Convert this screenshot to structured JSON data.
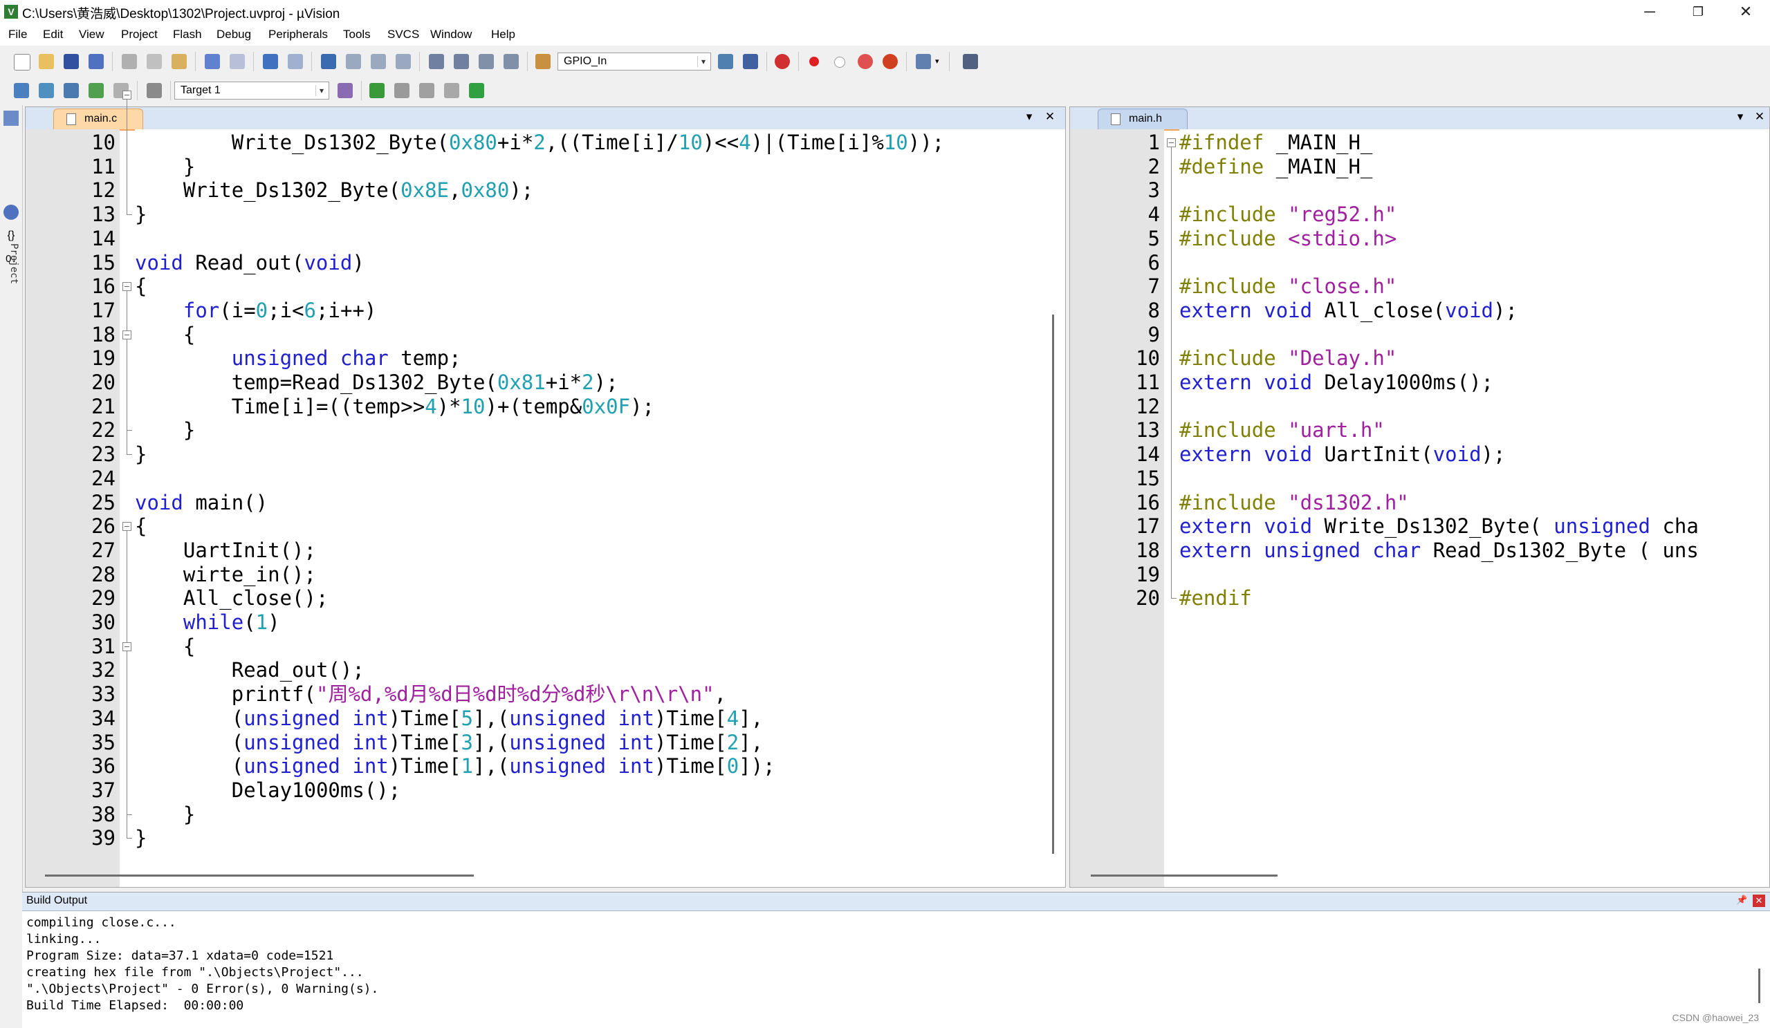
{
  "window": {
    "title": "C:\\Users\\黄浩威\\Desktop\\1302\\Project.uvproj - µVision",
    "minimize": "─",
    "restore": "❐",
    "close": "✕"
  },
  "menu": [
    "File",
    "Edit",
    "View",
    "Project",
    "Flash",
    "Debug",
    "Peripherals",
    "Tools",
    "SVCS",
    "Window",
    "Help"
  ],
  "toolbar": {
    "find_combo": "GPIO_In",
    "target_combo": "Target 1"
  },
  "sidebar": {
    "project_label": "Project"
  },
  "editor_left": {
    "tab": "main.c",
    "pane_menu": "▾",
    "pane_close": "✕",
    "lines": [
      {
        "n": "10",
        "code": "        Write_Ds1302_Byte(0x80+i*2,((Time[i]/10)<<4)|(Time[i]%10));"
      },
      {
        "n": "11",
        "code": "    }"
      },
      {
        "n": "12",
        "code": "    Write_Ds1302_Byte(0x8E,0x80);"
      },
      {
        "n": "13",
        "code": "}"
      },
      {
        "n": "14",
        "code": ""
      },
      {
        "n": "15",
        "code": "void Read_out(void)"
      },
      {
        "n": "16",
        "code": "{"
      },
      {
        "n": "17",
        "code": "    for(i=0;i<6;i++)"
      },
      {
        "n": "18",
        "code": "    {"
      },
      {
        "n": "19",
        "code": "        unsigned char temp;"
      },
      {
        "n": "20",
        "code": "        temp=Read_Ds1302_Byte(0x81+i*2);"
      },
      {
        "n": "21",
        "code": "        Time[i]=((temp>>4)*10)+(temp&0x0F);"
      },
      {
        "n": "22",
        "code": "    }"
      },
      {
        "n": "23",
        "code": "}"
      },
      {
        "n": "24",
        "code": ""
      },
      {
        "n": "25",
        "code": "void main()"
      },
      {
        "n": "26",
        "code": "{"
      },
      {
        "n": "27",
        "code": "    UartInit();"
      },
      {
        "n": "28",
        "code": "    wirte_in();"
      },
      {
        "n": "29",
        "code": "    All_close();"
      },
      {
        "n": "30",
        "code": "    while(1)"
      },
      {
        "n": "31",
        "code": "    {"
      },
      {
        "n": "32",
        "code": "        Read_out();"
      },
      {
        "n": "33",
        "code": "        printf(\"周%d,%d月%d日%d时%d分%d秒\\r\\n\\r\\n\","
      },
      {
        "n": "34",
        "code": "        (unsigned int)Time[5],(unsigned int)Time[4],"
      },
      {
        "n": "35",
        "code": "        (unsigned int)Time[3],(unsigned int)Time[2],"
      },
      {
        "n": "36",
        "code": "        (unsigned int)Time[1],(unsigned int)Time[0]);"
      },
      {
        "n": "37",
        "code": "        Delay1000ms();"
      },
      {
        "n": "38",
        "code": "    }"
      },
      {
        "n": "39",
        "code": "}"
      }
    ]
  },
  "editor_right": {
    "tab": "main.h",
    "pane_menu": "▾",
    "pane_close": "✕",
    "lines": [
      {
        "n": "1",
        "code": "#ifndef _MAIN_H_"
      },
      {
        "n": "2",
        "code": "#define _MAIN_H_"
      },
      {
        "n": "3",
        "code": ""
      },
      {
        "n": "4",
        "code": "#include \"reg52.h\""
      },
      {
        "n": "5",
        "code": "#include <stdio.h>"
      },
      {
        "n": "6",
        "code": ""
      },
      {
        "n": "7",
        "code": "#include \"close.h\""
      },
      {
        "n": "8",
        "code": "extern void All_close(void);"
      },
      {
        "n": "9",
        "code": ""
      },
      {
        "n": "10",
        "code": "#include \"Delay.h\""
      },
      {
        "n": "11",
        "code": "extern void Delay1000ms();"
      },
      {
        "n": "12",
        "code": ""
      },
      {
        "n": "13",
        "code": "#include \"uart.h\""
      },
      {
        "n": "14",
        "code": "extern void UartInit(void);"
      },
      {
        "n": "15",
        "code": ""
      },
      {
        "n": "16",
        "code": "#include \"ds1302.h\""
      },
      {
        "n": "17",
        "code": "extern void Write_Ds1302_Byte( unsigned cha"
      },
      {
        "n": "18",
        "code": "extern unsigned char Read_Ds1302_Byte ( uns"
      },
      {
        "n": "19",
        "code": ""
      },
      {
        "n": "20",
        "code": "#endif"
      }
    ]
  },
  "build_output": {
    "title": "Build Output",
    "pin": "📌",
    "close": "✕",
    "lines": [
      "compiling close.c...",
      "linking...",
      "Program Size: data=37.1 xdata=0 code=1521",
      "creating hex file from \".\\Objects\\Project\"...",
      "\".\\Objects\\Project\" - 0 Error(s), 0 Warning(s).",
      "Build Time Elapsed:  00:00:00"
    ]
  },
  "watermark": "CSDN @haowei_23",
  "colors": {
    "keyword": "#2020d0",
    "number": "#20a0b0",
    "string": "#a020a0",
    "preprocessor": "#808000",
    "active_tab": "#ffd8a8",
    "tab_strip": "#d9e4f5"
  }
}
